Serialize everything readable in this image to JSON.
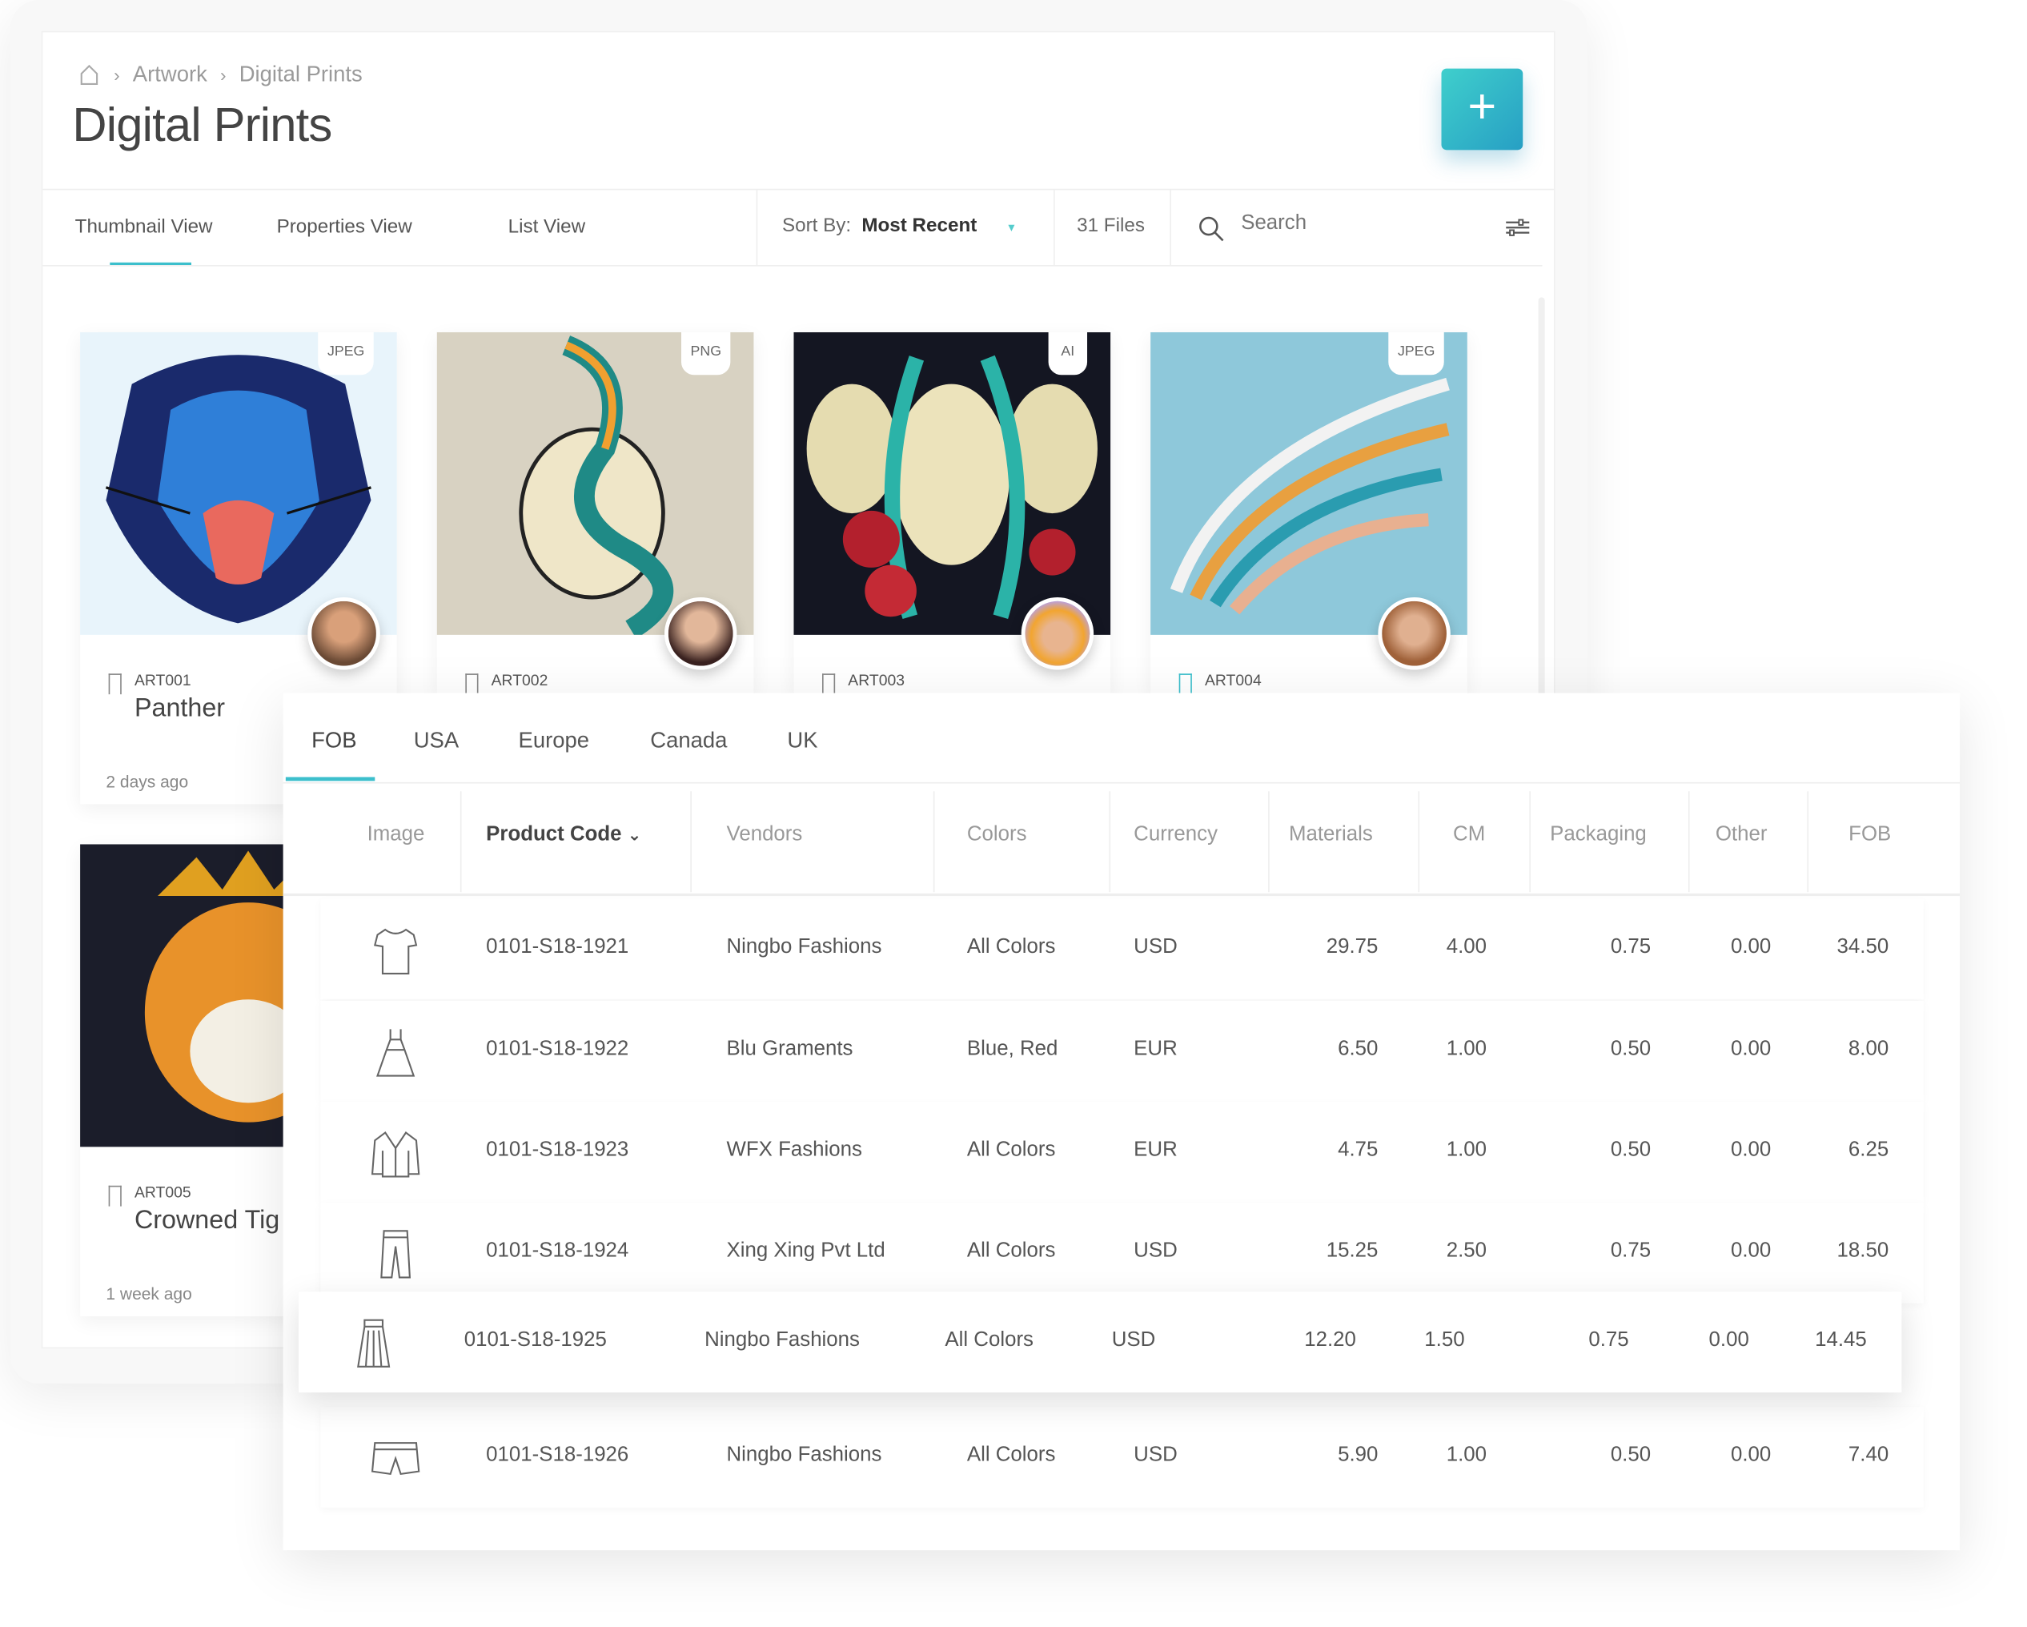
{
  "breadcrumb": {
    "items": [
      "Artwork",
      "Digital Prints"
    ]
  },
  "header": {
    "title": "Digital Prints",
    "add_label": "+"
  },
  "view_tabs": [
    "Thumbnail View",
    "Properties View",
    "List View"
  ],
  "toolbar": {
    "sort_label": "Sort By:",
    "sort_value": "Most Recent",
    "file_count": "31 Files",
    "search_placeholder": "Search"
  },
  "colors": {
    "accent": "#3cbfcc",
    "button_start": "#3fcfcc",
    "button_end": "#279fc4"
  },
  "cards": [
    {
      "format": "JPEG",
      "code": "ART001",
      "name": "Panther",
      "ago": "2 days ago"
    },
    {
      "format": "PNG",
      "code": "ART002"
    },
    {
      "format": "AI",
      "code": "ART003"
    },
    {
      "format": "JPEG",
      "code": "ART004"
    },
    {
      "code": "ART005",
      "name": "Crowned Tig",
      "ago": "1 week ago"
    }
  ],
  "price_tabs": [
    "FOB",
    "USA",
    "Europe",
    "Canada",
    "UK"
  ],
  "table": {
    "headers": [
      "Image",
      "Product Code",
      "Vendors",
      "Colors",
      "Currency",
      "Materials",
      "CM",
      "Packaging",
      "Other",
      "FOB"
    ],
    "rows": [
      {
        "icon": "tshirt-icon",
        "code": "0101-S18-1921",
        "vendor": "Ningbo Fashions",
        "colors": "All Colors",
        "currency": "USD",
        "materials": "29.75",
        "cm": "4.00",
        "packaging": "0.75",
        "other": "0.00",
        "fob": "34.50"
      },
      {
        "icon": "dress-icon",
        "code": "0101-S18-1922",
        "vendor": "Blu Graments",
        "colors": "Blue, Red",
        "currency": "EUR",
        "materials": "6.50",
        "cm": "1.00",
        "packaging": "0.50",
        "other": "0.00",
        "fob": "8.00"
      },
      {
        "icon": "jacket-icon",
        "code": "0101-S18-1923",
        "vendor": "WFX Fashions",
        "colors": "All Colors",
        "currency": "EUR",
        "materials": "4.75",
        "cm": "1.00",
        "packaging": "0.50",
        "other": "0.00",
        "fob": "6.25"
      },
      {
        "icon": "pants-icon",
        "code": "0101-S18-1924",
        "vendor": "Xing Xing Pvt Ltd",
        "colors": "All Colors",
        "currency": "USD",
        "materials": "15.25",
        "cm": "2.50",
        "packaging": "0.75",
        "other": "0.00",
        "fob": "18.50"
      },
      {
        "icon": "skirt-icon",
        "code": "0101-S18-1925",
        "vendor": "Ningbo Fashions",
        "colors": "All Colors",
        "currency": "USD",
        "materials": "12.20",
        "cm": "1.50",
        "packaging": "0.75",
        "other": "0.00",
        "fob": "14.45"
      },
      {
        "icon": "shorts-icon",
        "code": "0101-S18-1926",
        "vendor": "Ningbo Fashions",
        "colors": "All Colors",
        "currency": "USD",
        "materials": "5.90",
        "cm": "1.00",
        "packaging": "0.50",
        "other": "0.00",
        "fob": "7.40"
      }
    ]
  }
}
